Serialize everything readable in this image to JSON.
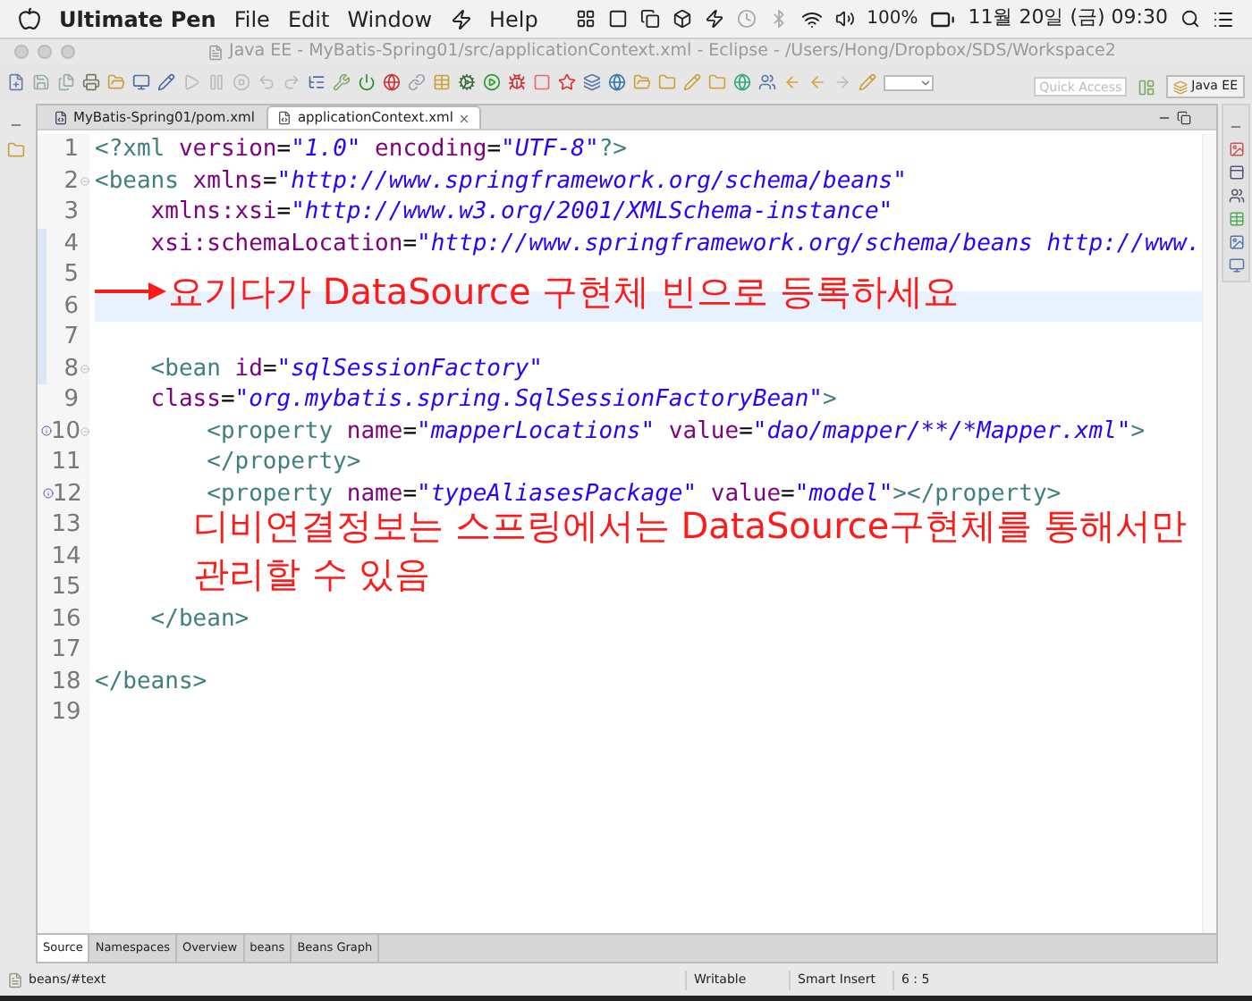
{
  "menubar": {
    "app": "Ultimate Pen",
    "menus": [
      "File",
      "Edit",
      "Window"
    ],
    "menus_after": [
      "Help"
    ],
    "battery": "100%",
    "clock": "11월 20일 (금) 09:30"
  },
  "window": {
    "title": "Java EE - MyBatis-Spring01/src/applicationContext.xml - Eclipse - /Users/Hong/Dropbox/SDS/Workspace2"
  },
  "toolbar": {
    "quick_access": {
      "placeholder": "Quick Access"
    },
    "perspective": "Java EE"
  },
  "editor_tabs": [
    {
      "label": "MyBatis-Spring01/pom.xml",
      "selected": false
    },
    {
      "label": "applicationContext.xml",
      "selected": true
    }
  ],
  "code": {
    "lines": [
      {
        "number": "1",
        "fold": false,
        "info": false,
        "changed": false,
        "selected": false,
        "segments": [
          {
            "kind": "tag",
            "text": "<?xml"
          },
          {
            "kind": "attr",
            "text": " version"
          },
          {
            "kind": "plain",
            "text": "="
          },
          {
            "kind": "value",
            "text": "\"1.0\""
          },
          {
            "kind": "attr",
            "text": " encoding"
          },
          {
            "kind": "plain",
            "text": "="
          },
          {
            "kind": "value",
            "text": "\"UTF-8\""
          },
          {
            "kind": "tag",
            "text": "?>"
          }
        ]
      },
      {
        "number": "2",
        "fold": true,
        "info": false,
        "changed": false,
        "selected": false,
        "segments": [
          {
            "kind": "tag",
            "text": "<beans"
          },
          {
            "kind": "attr",
            "text": " xmlns"
          },
          {
            "kind": "plain",
            "text": "="
          },
          {
            "kind": "value",
            "text": "\"http://www.springframework.org/schema/beans\""
          }
        ]
      },
      {
        "number": "3",
        "fold": false,
        "info": false,
        "changed": false,
        "selected": false,
        "segments": [
          {
            "kind": "attr",
            "text": "    xmlns:xsi"
          },
          {
            "kind": "plain",
            "text": "="
          },
          {
            "kind": "value",
            "text": "\"http://www.w3.org/2001/XMLSchema-instance\""
          }
        ]
      },
      {
        "number": "4",
        "fold": false,
        "info": false,
        "changed": true,
        "selected": false,
        "segments": [
          {
            "kind": "attr",
            "text": "    xsi:schemaLocation"
          },
          {
            "kind": "plain",
            "text": "="
          },
          {
            "kind": "value",
            "text": "\"http://www.springframework.org/schema/beans http://www."
          }
        ]
      },
      {
        "number": "5",
        "fold": false,
        "info": false,
        "changed": true,
        "selected": false,
        "note": {
          "kind": "arrow",
          "text": "요기다가 DataSource 구현체 빈으로 등록하세요"
        }
      },
      {
        "number": "6",
        "fold": false,
        "info": false,
        "changed": true,
        "selected": true
      },
      {
        "number": "7",
        "fold": false,
        "info": false,
        "changed": true,
        "selected": false
      },
      {
        "number": "8",
        "fold": true,
        "info": false,
        "changed": true,
        "selected": false,
        "segments": [
          {
            "kind": "tag",
            "text": "    <bean"
          },
          {
            "kind": "attr",
            "text": " id"
          },
          {
            "kind": "plain",
            "text": "="
          },
          {
            "kind": "value",
            "text": "\"sqlSessionFactory\""
          }
        ]
      },
      {
        "number": "9",
        "fold": false,
        "info": false,
        "changed": false,
        "selected": false,
        "segments": [
          {
            "kind": "attr",
            "text": "    class"
          },
          {
            "kind": "plain",
            "text": "="
          },
          {
            "kind": "value",
            "text": "\"org.mybatis.spring.SqlSessionFactoryBean\""
          },
          {
            "kind": "tag",
            "text": ">"
          }
        ]
      },
      {
        "number": "10",
        "fold": true,
        "info": true,
        "changed": false,
        "selected": false,
        "segments": [
          {
            "kind": "tag",
            "text": "        <property"
          },
          {
            "kind": "attr",
            "text": " name"
          },
          {
            "kind": "plain",
            "text": "="
          },
          {
            "kind": "value",
            "text": "\"mapperLocations\""
          },
          {
            "kind": "attr",
            "text": " value"
          },
          {
            "kind": "plain",
            "text": "="
          },
          {
            "kind": "value",
            "text": "\"dao/mapper/**/*Mapper.xml\""
          },
          {
            "kind": "tag",
            "text": ">"
          }
        ]
      },
      {
        "number": "11",
        "fold": false,
        "info": false,
        "changed": false,
        "selected": false,
        "segments": [
          {
            "kind": "tag",
            "text": "        </property>"
          }
        ]
      },
      {
        "number": "12",
        "fold": false,
        "info": true,
        "changed": false,
        "selected": false,
        "segments": [
          {
            "kind": "tag",
            "text": "        <property"
          },
          {
            "kind": "attr",
            "text": " name"
          },
          {
            "kind": "plain",
            "text": "="
          },
          {
            "kind": "value",
            "text": "\"typeAliasesPackage\""
          },
          {
            "kind": "attr",
            "text": " value"
          },
          {
            "kind": "plain",
            "text": "="
          },
          {
            "kind": "value",
            "text": "\"model\""
          },
          {
            "kind": "tag",
            "text": "></property>"
          }
        ]
      },
      {
        "number": "13",
        "fold": false,
        "info": false,
        "changed": false,
        "selected": false
      },
      {
        "number": "14",
        "fold": false,
        "info": false,
        "changed": false,
        "selected": false,
        "note": {
          "kind": "text",
          "text": "디비연결정보는 스프링에서는 DataSource구현체를 통해서만\n관리할 수 있음"
        }
      },
      {
        "number": "15",
        "fold": false,
        "info": false,
        "changed": false,
        "selected": false
      },
      {
        "number": "16",
        "fold": false,
        "info": false,
        "changed": false,
        "selected": false,
        "segments": [
          {
            "kind": "tag",
            "text": "    </bean>"
          }
        ]
      },
      {
        "number": "17",
        "fold": false,
        "info": false,
        "changed": false,
        "selected": false
      },
      {
        "number": "18",
        "fold": false,
        "info": false,
        "changed": false,
        "selected": false,
        "segments": [
          {
            "kind": "tag",
            "text": "</beans>"
          }
        ]
      },
      {
        "number": "19",
        "fold": false,
        "info": false,
        "changed": false,
        "selected": false
      }
    ]
  },
  "bottom_tabs": [
    {
      "label": "Source",
      "selected": true
    },
    {
      "label": "Namespaces",
      "selected": false
    },
    {
      "label": "Overview",
      "selected": false
    },
    {
      "label": "beans",
      "selected": false
    },
    {
      "label": "Beans Graph",
      "selected": false
    }
  ],
  "status_bar": {
    "path": "beans/#text",
    "mode": "Writable",
    "insert": "Smart Insert",
    "position": "6 : 5"
  }
}
